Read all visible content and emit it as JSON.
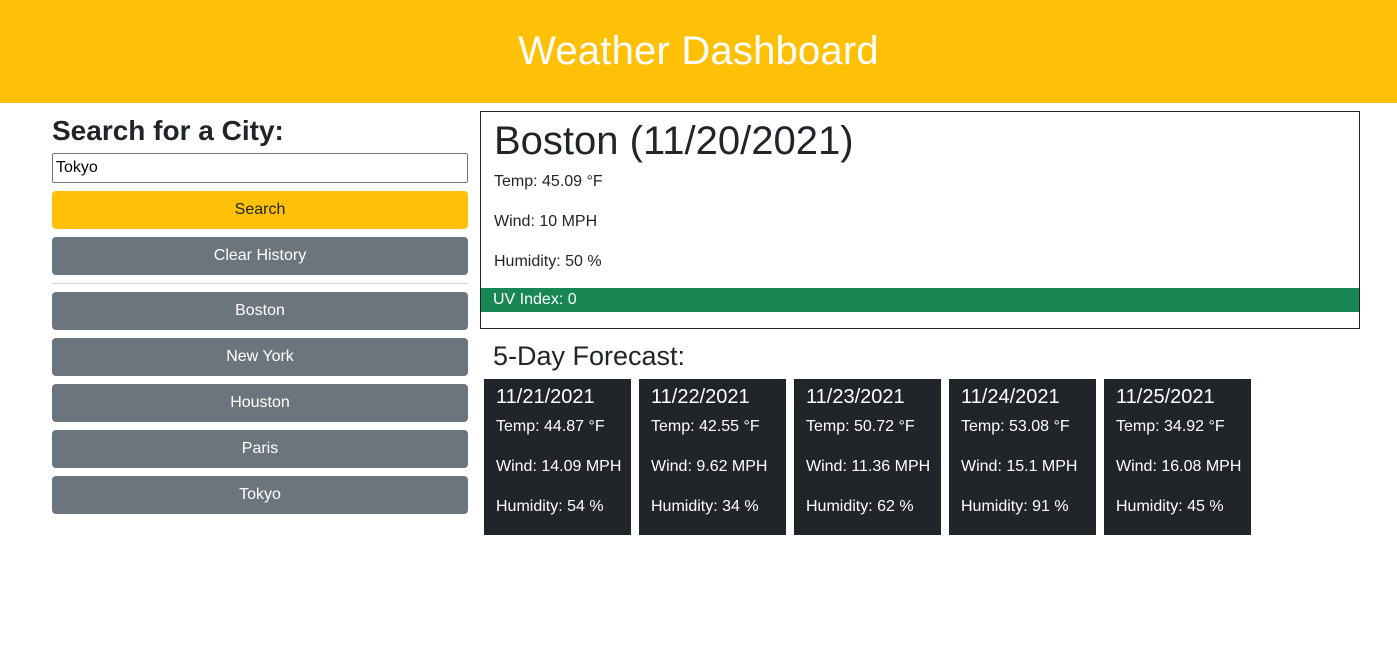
{
  "header": {
    "title": "Weather Dashboard"
  },
  "search": {
    "heading": "Search for a City:",
    "input_value": "Tokyo",
    "search_label": "Search",
    "clear_label": "Clear History"
  },
  "history": [
    "Boston",
    "New York",
    "Houston",
    "Paris",
    "Tokyo"
  ],
  "current": {
    "title": "Boston (11/20/2021)",
    "temp": "Temp: 45.09 °F",
    "wind": "Wind: 10 MPH",
    "humidity": "Humidity: 50 %",
    "uv": "UV Index: 0",
    "uv_color": "#198754"
  },
  "forecast_title": "5-Day Forecast:",
  "forecast": [
    {
      "date": "11/21/2021",
      "temp": "Temp: 44.87 °F",
      "wind": "Wind: 14.09 MPH",
      "humidity": "Humidity: 54 %"
    },
    {
      "date": "11/22/2021",
      "temp": "Temp: 42.55 °F",
      "wind": "Wind: 9.62 MPH",
      "humidity": "Humidity: 34 %"
    },
    {
      "date": "11/23/2021",
      "temp": "Temp: 50.72 °F",
      "wind": "Wind: 11.36 MPH",
      "humidity": "Humidity: 62 %"
    },
    {
      "date": "11/24/2021",
      "temp": "Temp: 53.08 °F",
      "wind": "Wind: 15.1 MPH",
      "humidity": "Humidity: 91 %"
    },
    {
      "date": "11/25/2021",
      "temp": "Temp: 34.92 °F",
      "wind": "Wind: 16.08 MPH",
      "humidity": "Humidity: 45 %"
    }
  ],
  "colors": {
    "accent": "#ffc107",
    "history_button": "#6c757d",
    "forecast_card": "#212529"
  }
}
